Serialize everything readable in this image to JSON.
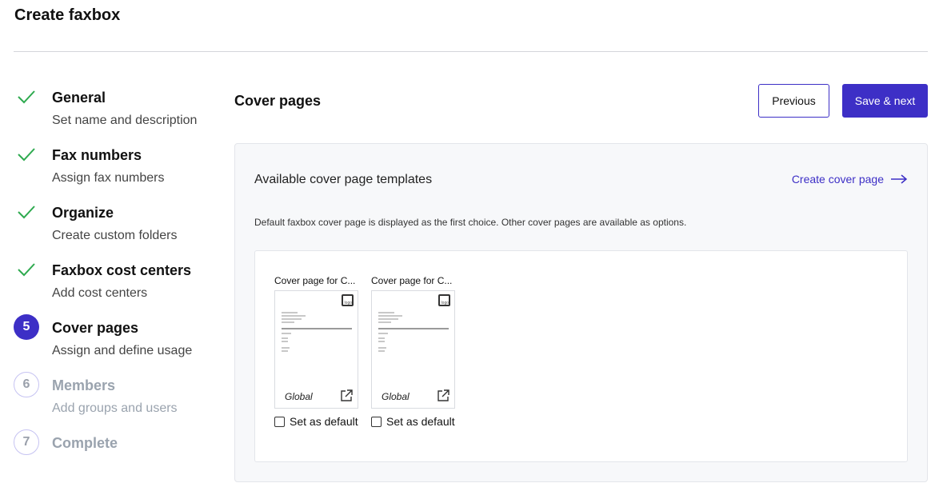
{
  "page_title": "Create faxbox",
  "steps": [
    {
      "status": "done",
      "title": "General",
      "subtitle": "Set name and description"
    },
    {
      "status": "done",
      "title": "Fax numbers",
      "subtitle": "Assign fax numbers"
    },
    {
      "status": "done",
      "title": "Organize",
      "subtitle": "Create custom folders"
    },
    {
      "status": "done",
      "title": "Faxbox cost centers",
      "subtitle": "Add cost centers"
    },
    {
      "status": "active",
      "number": "5",
      "title": "Cover pages",
      "subtitle": "Assign and define usage"
    },
    {
      "status": "pending",
      "number": "6",
      "title": "Members",
      "subtitle": "Add groups and users"
    },
    {
      "status": "pending",
      "number": "7",
      "title": "Complete",
      "subtitle": ""
    }
  ],
  "section_title": "Cover pages",
  "buttons": {
    "previous": "Previous",
    "save_next": "Save & next"
  },
  "panel": {
    "heading": "Available cover page templates",
    "create_link": "Create cover page",
    "description": "Default faxbox cover page is displayed as the first choice. Other cover pages are available as options."
  },
  "templates": [
    {
      "name": "Cover page for C...",
      "tag": "Global",
      "default_label": "Set as default",
      "is_default": false,
      "thumb_logo": "logo"
    },
    {
      "name": "Cover page for C...",
      "tag": "Global",
      "default_label": "Set as default",
      "is_default": false,
      "thumb_logo": "logo"
    }
  ],
  "colors": {
    "accent": "#3d2fc6",
    "check": "#2eaa4f",
    "pending": "#9aa3ae"
  }
}
